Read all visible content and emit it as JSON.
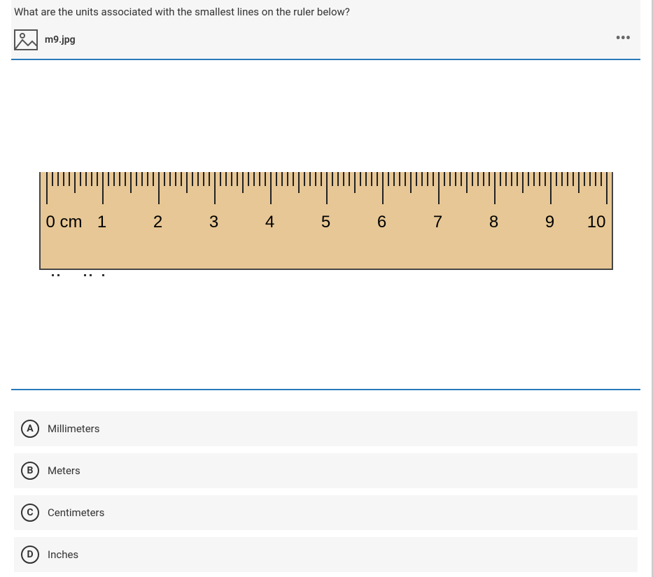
{
  "question": {
    "text": "What are the units associated with the smallest lines on the ruler below?",
    "attachment": "m9.jpg"
  },
  "ruler": {
    "labels": [
      "0 cm",
      "1",
      "2",
      "3",
      "4",
      "5",
      "6",
      "7",
      "8",
      "9",
      "10"
    ]
  },
  "answers": [
    {
      "letter": "A",
      "text": "Millimeters"
    },
    {
      "letter": "B",
      "text": "Meters"
    },
    {
      "letter": "C",
      "text": "Centimeters"
    },
    {
      "letter": "D",
      "text": "Inches"
    }
  ]
}
